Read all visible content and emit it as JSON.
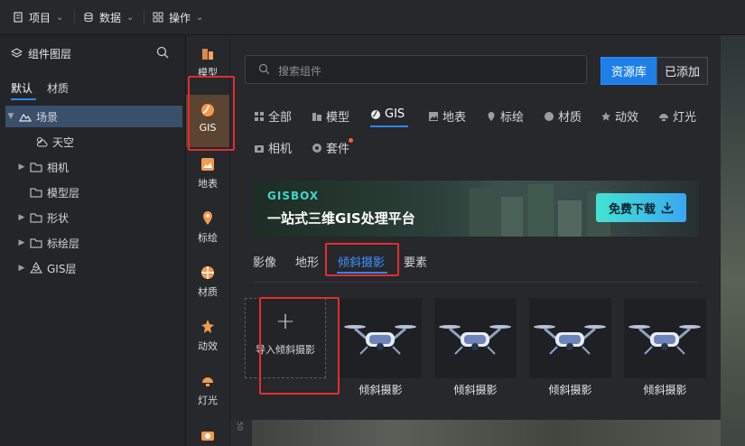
{
  "topbar": {
    "items": [
      {
        "label": "项目",
        "icon": "document-icon"
      },
      {
        "label": "数据",
        "icon": "database-icon"
      },
      {
        "label": "操作",
        "icon": "grid-icon"
      }
    ]
  },
  "layer_panel": {
    "title": "组件图层",
    "tabs": [
      "默认",
      "材质"
    ],
    "tree": [
      {
        "label": "场景",
        "icon": "mountain-icon",
        "expanded": true,
        "selected": true
      },
      {
        "label": "天空",
        "icon": "cloud-sun-icon"
      },
      {
        "label": "相机",
        "icon": "folder-icon",
        "collapsible": true
      },
      {
        "label": "模型层",
        "icon": "folder-icon"
      },
      {
        "label": "形状",
        "icon": "folder-icon",
        "collapsible": true
      },
      {
        "label": "标绘层",
        "icon": "folder-icon",
        "collapsible": true
      },
      {
        "label": "GIS层",
        "icon": "gis-layer-icon",
        "collapsible": true
      }
    ]
  },
  "iconbar": {
    "items": [
      {
        "label": "模型",
        "icon": "model-icon"
      },
      {
        "label": "GIS",
        "icon": "gis-icon",
        "active": true
      },
      {
        "label": "地表",
        "icon": "terrain-icon"
      },
      {
        "label": "标绘",
        "icon": "pin-icon"
      },
      {
        "label": "材质",
        "icon": "material-icon"
      },
      {
        "label": "动效",
        "icon": "effect-icon"
      },
      {
        "label": "灯光",
        "icon": "light-icon"
      }
    ]
  },
  "main": {
    "search_placeholder": "搜索组件",
    "btn_library": "资源库",
    "btn_added": "已添加",
    "categories": [
      "全部",
      "模型",
      "GIS",
      "地表",
      "标绘",
      "材质",
      "动效",
      "灯光",
      "相机",
      "套件"
    ],
    "banner": {
      "logo": "GISBOX",
      "slogan": "一站式三维GIS处理平台",
      "download": "免费下载"
    },
    "subtabs": [
      "影像",
      "地形",
      "倾斜摄影",
      "要素"
    ],
    "import_label": "导入倾斜摄影",
    "tiles": [
      "倾斜摄影",
      "倾斜摄影",
      "倾斜摄影",
      "倾斜摄影"
    ]
  },
  "ruler": {
    "label": "50"
  },
  "colors": {
    "accent": "#2f86f6",
    "highlight": "#e32d2d",
    "active_bg": "#5b4431"
  }
}
